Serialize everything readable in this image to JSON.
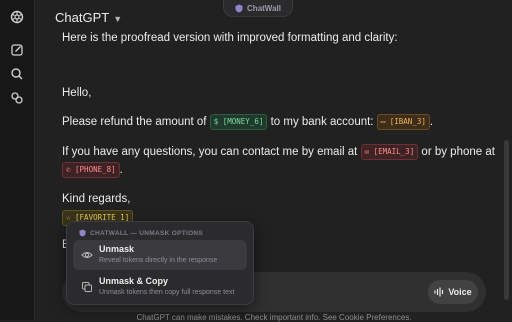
{
  "header": {
    "title": "ChatGPT"
  },
  "extension": {
    "name": "ChatWall"
  },
  "message": {
    "intro": "Here is the proofread version with improved formatting and clarity:",
    "greeting": "Hello,",
    "refund_a": "Please refund the amount of",
    "refund_b": "to my bank account:",
    "refund_c": ".",
    "contact_a": "If you have any questions, you can contact me by email at",
    "contact_b": "or by phone at",
    "phone_end": ".",
    "closing": "Kind regards,",
    "partial_line": "E"
  },
  "tokens": {
    "money": "[MONEY_6]",
    "iban": "[IBAN_3]",
    "email": "[EMAIL_3]",
    "phone": "[PHONE_8]",
    "favorite": "[FAVORITE_1]"
  },
  "popup": {
    "header": "CHATWALL — UNMASK OPTIONS",
    "options": [
      {
        "title": "Unmask",
        "desc": "Reveal tokens directly in the response"
      },
      {
        "title": "Unmask & Copy",
        "desc": "Unmask tokens then copy full response text"
      }
    ]
  },
  "composer": {
    "voice_label": "Voice"
  },
  "footer": {
    "disclaimer": "ChatGPT can make mistakes. Check important info. See Cookie Preferences."
  },
  "colors": {
    "background": "#212121",
    "money_token": "#7cd9a1",
    "iban_token": "#f0b45c",
    "email_token": "#ff8a8a",
    "favorite_token": "#e8cd63"
  },
  "icons": [
    "openai-logo-icon",
    "new-chat-icon",
    "search-icon",
    "library-icon",
    "chatwall-shield-icon",
    "eye-icon",
    "copy-icon",
    "voice-wave-icon"
  ]
}
